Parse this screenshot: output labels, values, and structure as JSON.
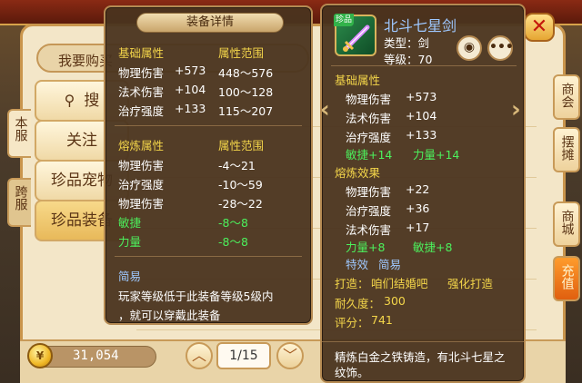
{
  "shop": {
    "title_pill": "我要购买",
    "left_tabs": [
      {
        "label": "本服"
      },
      {
        "label": "跨服"
      }
    ],
    "categories": [
      {
        "label": "搜"
      },
      {
        "label": "关注"
      },
      {
        "label": "珍品宠物"
      },
      {
        "label": "珍品装备"
      }
    ],
    "right_tabs": [
      {
        "label": "商会"
      },
      {
        "label": "摆摊"
      },
      {
        "label": "商城"
      },
      {
        "label": "充值"
      }
    ],
    "close_label": "✕",
    "coin_amount": "31,054",
    "coin_icon": "coin-icon",
    "pager": {
      "text": "1/15",
      "up_glyph": "︿",
      "down_glyph": "﹀"
    }
  },
  "detail": {
    "title": "装备详情",
    "base_header": {
      "left": "基础属性",
      "right": "属性范围"
    },
    "base_rows": [
      {
        "attr": "物理伤害",
        "value": "+573",
        "range": "448～576"
      },
      {
        "attr": "法术伤害",
        "value": "+104",
        "range": "100～128"
      },
      {
        "attr": "治疗强度",
        "value": "+133",
        "range": "115～207"
      }
    ],
    "forge_header": {
      "left": "熔炼属性",
      "right": "属性范围"
    },
    "forge_rows": [
      {
        "attr": "物理伤害",
        "range": "-4～21",
        "color": "#ffffff"
      },
      {
        "attr": "治疗强度",
        "range": "-10～59",
        "color": "#ffffff"
      },
      {
        "attr": "物理伤害",
        "range": "-28～22",
        "color": "#ffffff"
      },
      {
        "attr": "敏捷",
        "range": "-8～8",
        "color": "#4cf05c"
      },
      {
        "attr": "力量",
        "range": "-8～8",
        "color": "#4cf05c"
      }
    ],
    "easy_header": "简易",
    "easy_text_1": "玩家等级低于此装备等级5级内",
    "easy_text_2": "，就可以穿戴此装备"
  },
  "item": {
    "name": "北斗七星剑",
    "badge": "珍品",
    "type_label": "类型：剑",
    "level_label": "等级：70",
    "eye_icon": "eye-icon",
    "more_icon": "more-icon",
    "base_header": "基础属性",
    "base_rows": [
      {
        "attr": "物理伤害",
        "value": "+573"
      },
      {
        "attr": "法术伤害",
        "value": "+104"
      },
      {
        "attr": "治疗强度",
        "value": "+133"
      }
    ],
    "base_bonus": {
      "a": "敏捷+14",
      "b": "力量+14"
    },
    "forge_header": "熔炼效果",
    "forge_rows": [
      {
        "attr": "物理伤害",
        "value": "+22"
      },
      {
        "attr": "治疗强度",
        "value": "+36"
      },
      {
        "attr": "法术伤害",
        "value": "+17"
      }
    ],
    "forge_bonus": {
      "a": "力量+8",
      "b": "敏捷+8"
    },
    "special_label": "特效",
    "special_value": "简易",
    "forge_by_label": "打造：",
    "forge_by_value": "咱们结婚吧",
    "enhance_label": "强化打造",
    "durability_label": "耐久度：",
    "durability_value": "300",
    "score_label": "评分：",
    "score_value": "741",
    "description": "精炼白金之铁铸造，有北斗七星之纹饰。"
  }
}
